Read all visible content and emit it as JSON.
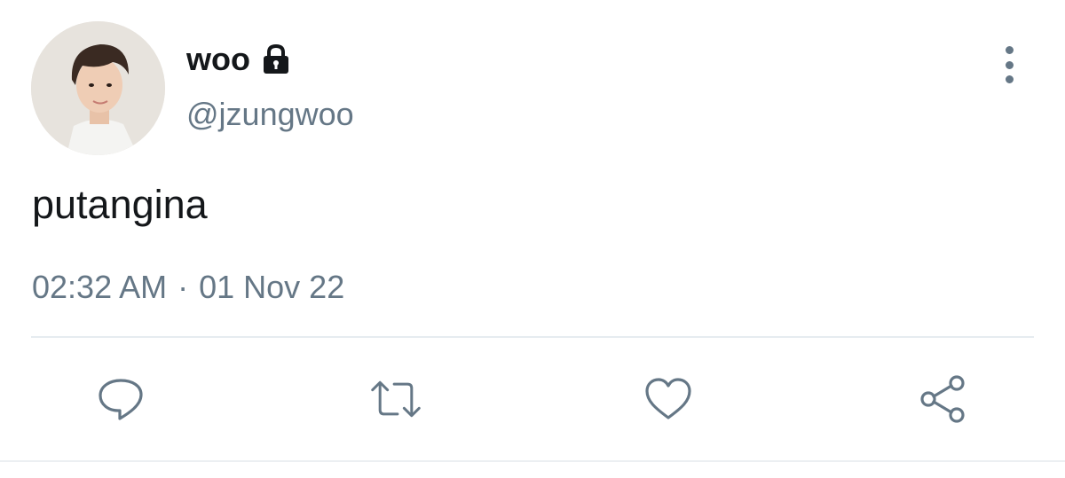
{
  "user": {
    "display_name": "woo",
    "handle": "@jzungwoo",
    "protected_icon": "lock-icon",
    "avatar": "avatar-photo"
  },
  "tweet": {
    "text": "putangina",
    "time": "02:32 AM",
    "separator": "·",
    "date": "01 Nov 22"
  },
  "menu": {
    "icon": "more-vertical-icon"
  },
  "actions": [
    {
      "name": "reply",
      "icon": "reply-icon"
    },
    {
      "name": "retweet",
      "icon": "retweet-icon"
    },
    {
      "name": "like",
      "icon": "heart-icon"
    },
    {
      "name": "share",
      "icon": "share-icon"
    }
  ],
  "colors": {
    "text": "#14171a",
    "secondary": "#657786",
    "divider": "#e6ecf0"
  }
}
